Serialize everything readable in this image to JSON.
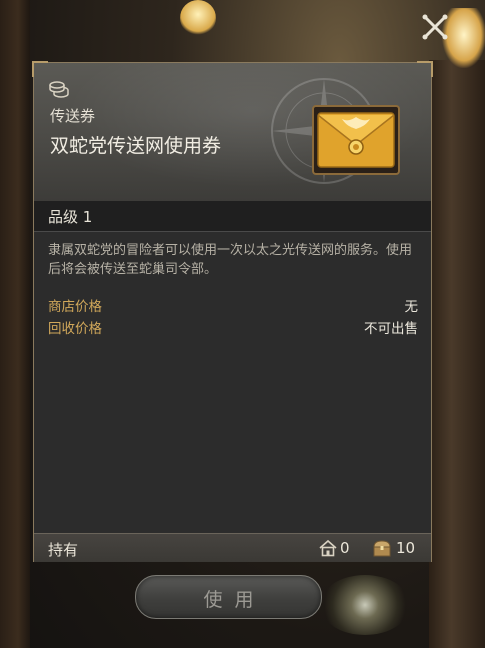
{
  "icons": {
    "close": "close-icon",
    "coin": "coin-stack-icon",
    "item": "envelope-ticket-icon",
    "house": "house-icon",
    "chest": "treasure-chest-icon"
  },
  "colors": {
    "label_gold": "#d0a75a",
    "text_light": "#ebe7dc",
    "panel_bg": "#2c2c2c",
    "envelope": "#e0a32c"
  },
  "item": {
    "category": "传送券",
    "name": "双蛇党传送网使用券",
    "grade": "品级 1",
    "description": "隶属双蛇党的冒险者可以使用一次以太之光传送网的服务。使用后将会被传送至蛇巢司令部。"
  },
  "info_rows": [
    {
      "label": "商店价格",
      "value": "无"
    },
    {
      "label": "回收价格",
      "value": "不可出售"
    }
  ],
  "footer": {
    "own_label": "持有",
    "house_count": "0",
    "chest_count": "10"
  },
  "actions": {
    "use_label": "使用"
  }
}
